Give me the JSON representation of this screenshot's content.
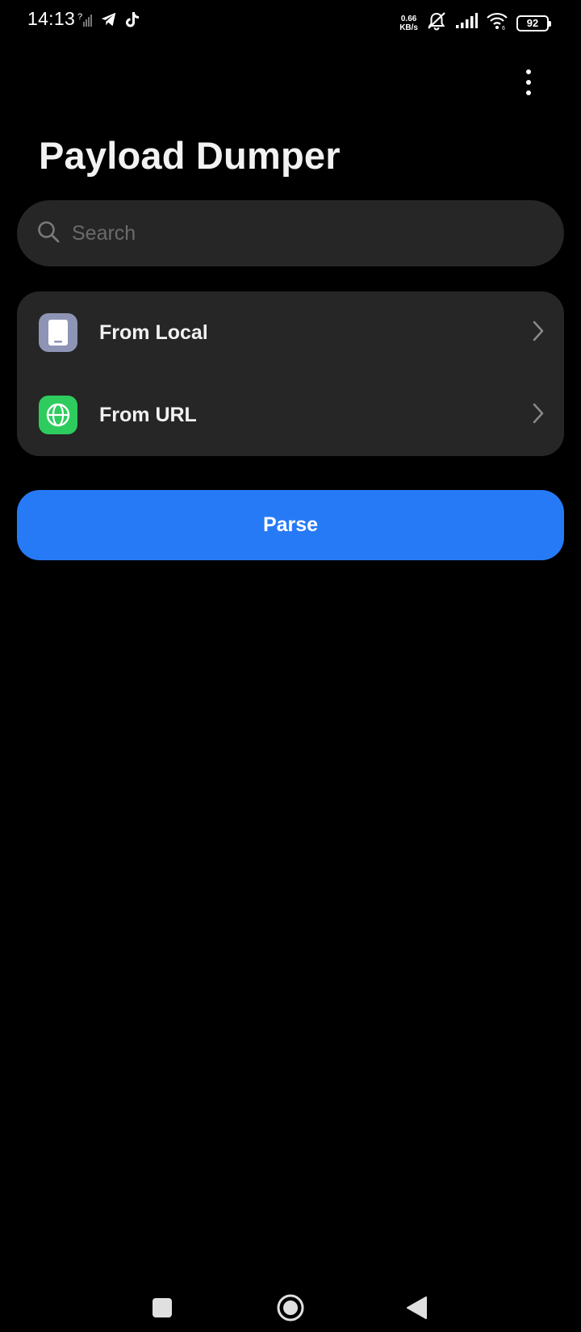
{
  "status_bar": {
    "time": "14:13",
    "net_speed_value": "0.66",
    "net_speed_unit": "KB/s",
    "battery": "92",
    "left_icons": [
      "sim-no-signal-icon",
      "telegram-icon",
      "tiktok-icon"
    ],
    "right_icons": [
      "bell-muted-icon",
      "cell-signal-icon",
      "wifi-icon",
      "battery-icon"
    ]
  },
  "header": {
    "title": "Payload Dumper",
    "menu_icon": "more-vertical-icon"
  },
  "search": {
    "placeholder": "Search",
    "icon": "search-icon"
  },
  "sources": [
    {
      "label": "From Local",
      "icon": "phone-icon",
      "icon_color": "#8e94b5"
    },
    {
      "label": "From URL",
      "icon": "globe-icon",
      "icon_color": "#2ecc5e"
    }
  ],
  "parse_button": {
    "label": "Parse"
  },
  "colors": {
    "background": "#000000",
    "card": "#262626",
    "accent": "#277af6",
    "text": "#f2f2f2",
    "placeholder": "#6b6b6b"
  },
  "nav_bar": {
    "buttons": [
      "recents-icon",
      "home-icon",
      "back-icon"
    ]
  }
}
